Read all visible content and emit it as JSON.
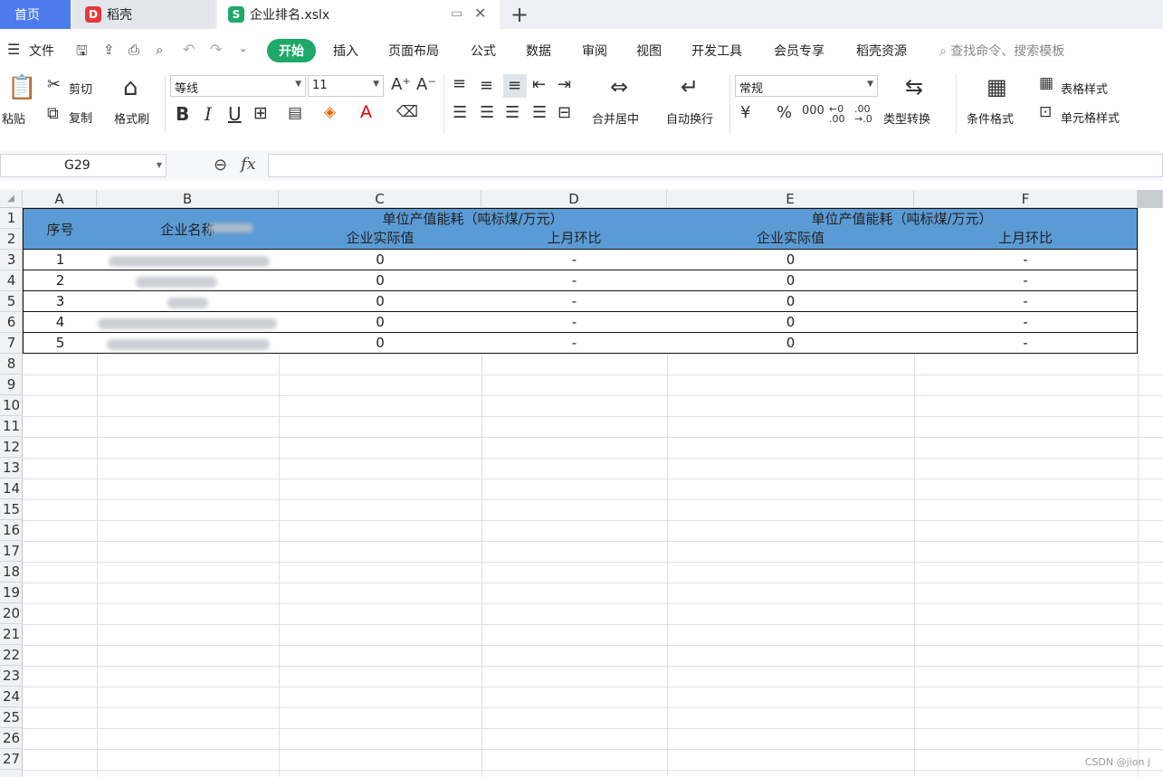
{
  "titlebar": {
    "tabs": [
      {
        "label": "首页"
      },
      {
        "label": "稻壳"
      },
      {
        "label": "企业排名.xslx"
      }
    ]
  },
  "menu": {
    "file_label": "文件",
    "items": [
      "开始",
      "插入",
      "页面布局",
      "公式",
      "数据",
      "审阅",
      "视图",
      "开发工具",
      "会员专享",
      "稻壳资源"
    ],
    "search_placeholder": "查找命令、搜索模板"
  },
  "ribbon": {
    "paste": "粘贴",
    "cut": "剪切",
    "copy": "复制",
    "format_painter": "格式刷",
    "font_name": "等线",
    "font_size": "11",
    "merge_center": "合并居中",
    "wrap_text": "自动换行",
    "number_format": "常规",
    "type_convert": "类型转换",
    "conditional_format": "条件格式",
    "table_style": "表格样式",
    "cell_style": "单元格样式"
  },
  "formula_bar": {
    "cell_ref": "G29",
    "formula": ""
  },
  "sheet": {
    "columns": [
      "A",
      "B",
      "C",
      "D",
      "E",
      "F"
    ],
    "rows": [
      "1",
      "2",
      "3",
      "4",
      "5",
      "6",
      "7",
      "8",
      "9",
      "10",
      "11",
      "12",
      "13",
      "14",
      "15",
      "16",
      "17",
      "18",
      "19",
      "20",
      "21",
      "22",
      "23",
      "24",
      "25",
      "26",
      "27"
    ],
    "header": {
      "seq": "序号",
      "company": "企业名称",
      "group1": "单位产值能耗（吨标煤/万元）",
      "group2": "单位产值能耗（吨标煤/万元）",
      "actual": "企业实际值",
      "mom": "上月环比"
    },
    "data": [
      {
        "seq": "1",
        "c": "0",
        "d": "-",
        "e": "0",
        "f": "-"
      },
      {
        "seq": "2",
        "c": "0",
        "d": "-",
        "e": "0",
        "f": "-"
      },
      {
        "seq": "3",
        "c": "0",
        "d": "-",
        "e": "0",
        "f": "-"
      },
      {
        "seq": "4",
        "c": "0",
        "d": "-",
        "e": "0",
        "f": "-"
      },
      {
        "seq": "5",
        "c": "0",
        "d": "-",
        "e": "0",
        "f": "-"
      }
    ]
  },
  "watermark": "CSDN @jion j",
  "colors": {
    "accent": "#1fa86a",
    "home_tab": "#4b7bec",
    "header_fill": "#5b9bd5"
  }
}
